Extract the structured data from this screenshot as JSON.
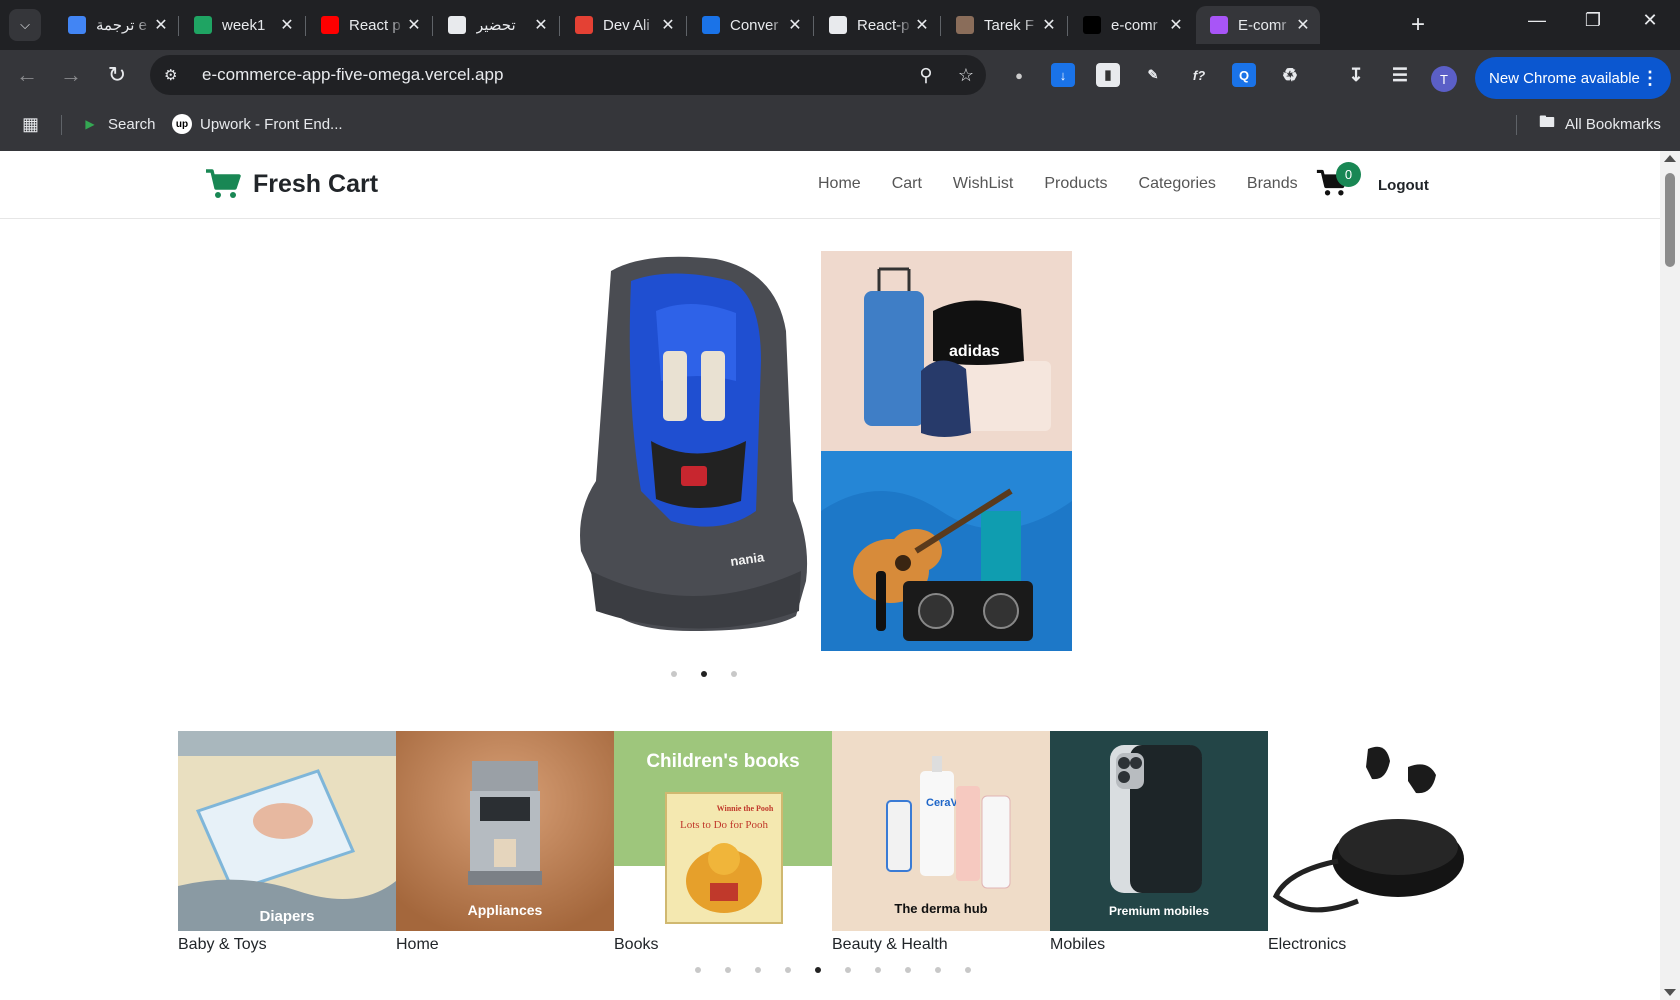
{
  "browser": {
    "tabs": [
      {
        "title": "ترجمة e",
        "favicon": "google-translate-icon",
        "color": "#4285f4"
      },
      {
        "title": "week1",
        "favicon": "google-drive-icon",
        "color": "#1fa463"
      },
      {
        "title": "React p",
        "favicon": "youtube-icon",
        "color": "#ff0000"
      },
      {
        "title": "تحضير",
        "favicon": "chatgpt-icon",
        "color": "#e8eaed"
      },
      {
        "title": "Dev Ali",
        "favicon": "pdf-icon",
        "color": "#e44134"
      },
      {
        "title": "Conver",
        "favicon": "convert-icon",
        "color": "#1a73e8"
      },
      {
        "title": "React-p",
        "favicon": "github-icon",
        "color": "#e8eaed"
      },
      {
        "title": "Tarek F",
        "favicon": "profile-icon",
        "color": "#8a6d5a"
      },
      {
        "title": "e-comr",
        "favicon": "vercel-icon",
        "color": "#000000"
      },
      {
        "title": "E-comr",
        "favicon": "vite-icon",
        "color": "#a855f7"
      }
    ],
    "url": "e-commerce-app-five-omega.vercel.app",
    "profile_initial": "T",
    "update_label": "New Chrome available",
    "bookmarks": [
      {
        "label": "Search",
        "icon": "search-bookmark-icon"
      },
      {
        "label": "Upwork - Front End...",
        "icon": "upwork-icon"
      }
    ],
    "all_bookmarks_label": "All Bookmarks"
  },
  "site": {
    "brand": "Fresh Cart",
    "accent": "#198754",
    "nav": [
      "Home",
      "Cart",
      "WishList",
      "Products",
      "Categories",
      "Brands"
    ],
    "cart_count": "0",
    "logout": "Logout"
  },
  "hero": {
    "main_image": "car-seat-image",
    "side_images": [
      "luggage-bags-image",
      "guitar-music-image"
    ],
    "side_text": "adidas",
    "dots": 3,
    "active_dot": 1
  },
  "categories": {
    "items": [
      {
        "label": "Baby & Toys",
        "overlay": "Diapers",
        "image": "diapers-image"
      },
      {
        "label": "Home",
        "overlay": "Appliances",
        "image": "coffee-machine-image"
      },
      {
        "label": "Books",
        "overlay": "Children's books",
        "image": "books-image"
      },
      {
        "label": "Beauty & Health",
        "overlay": "The derma hub",
        "image": "skincare-image"
      },
      {
        "label": "Mobiles",
        "overlay": "Premium mobiles",
        "image": "iphone-image"
      },
      {
        "label": "Electronics",
        "overlay": "",
        "image": "earbuds-image"
      }
    ],
    "book_cover_text": "Lots to Do for Pooh",
    "book_badge_text": "Winnie the Pooh",
    "skincare_brand_text": "CeraVe",
    "dots": 10,
    "active_dot": 4
  }
}
